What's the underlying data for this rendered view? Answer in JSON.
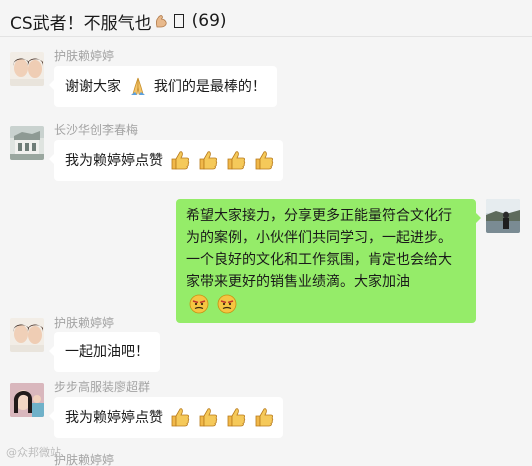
{
  "header": {
    "title": "CS武者！不服气也",
    "count": "(69)"
  },
  "messages": [
    {
      "sender": "护肤赖婷婷",
      "text": "谢谢大家",
      "text2": "我们的是最棒的！",
      "emoji": "pray-emoji"
    },
    {
      "sender": "长沙华创李春梅",
      "text": "我为赖婷婷点赞",
      "emoji": "thumbs-up-emoji"
    },
    {
      "sender": "",
      "text": "希望大家接力，分享更多正能量符合文化行为的案例，小伙伴们共同学习，一起进步。一个良好的文化和工作氛围，肯定也会给大家带来更好的销售业绩滴。大家加油",
      "emoji": "determined-face-emoji"
    },
    {
      "sender": "护肤赖婷婷",
      "text": "一起加油吧！"
    },
    {
      "sender": "步步高服装廖超群",
      "text": "我为赖婷婷点赞",
      "emoji": "thumbs-up-emoji"
    },
    {
      "sender": "护肤赖婷婷"
    }
  ],
  "watermark": "@众邦微站",
  "colors": {
    "background": "#f5f5f5",
    "bubble_other": "#ffffff",
    "bubble_self": "#95ec69",
    "sender_name": "#a3a3a3"
  }
}
